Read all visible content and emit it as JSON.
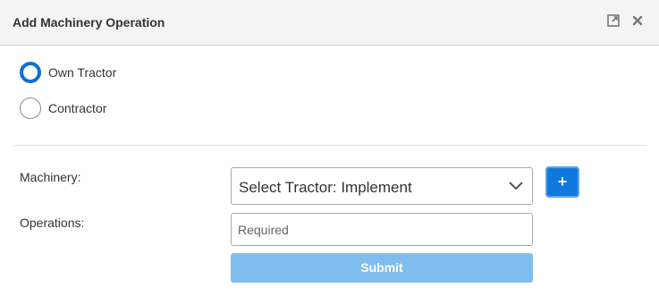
{
  "dialog": {
    "title": "Add Machinery Operation",
    "icons": {
      "expand": "expand-icon",
      "close": "close-icon"
    }
  },
  "radio_group": {
    "options": [
      {
        "label": "Own Tractor",
        "checked": true
      },
      {
        "label": "Contractor",
        "checked": false
      }
    ]
  },
  "form": {
    "machinery_label": "Machinery:",
    "machinery_select_value": "Select Tractor: Implement",
    "add_button_label": "+",
    "operations_label": "Operations:",
    "operations_placeholder": "Required",
    "operations_value": "",
    "submit_label": "Submit"
  },
  "colors": {
    "accent": "#0f6fd6",
    "add_button": "#1178dd",
    "submit_disabled": "#80bdee",
    "header_bg": "#f4f4f4"
  }
}
